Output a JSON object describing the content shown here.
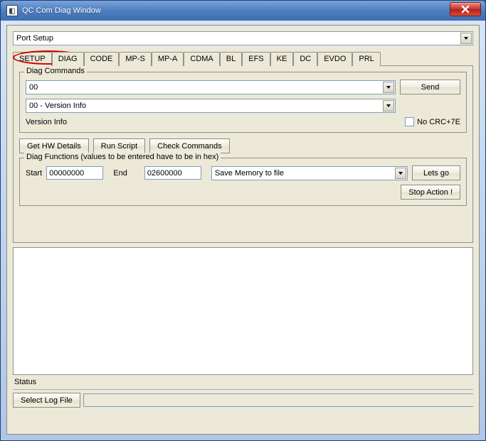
{
  "window": {
    "title": "QC Com Diag Window"
  },
  "port_dropdown": {
    "value": "Port Setup"
  },
  "tabs": [
    {
      "label": "SETUP"
    },
    {
      "label": "DIAG"
    },
    {
      "label": "CODE"
    },
    {
      "label": "MP-S"
    },
    {
      "label": "MP-A"
    },
    {
      "label": "CDMA"
    },
    {
      "label": "BL"
    },
    {
      "label": "EFS"
    },
    {
      "label": "KE"
    },
    {
      "label": "DC"
    },
    {
      "label": "EVDO"
    },
    {
      "label": "PRL"
    }
  ],
  "diag_commands": {
    "group_title": "Diag Commands",
    "cmd_value": "00",
    "send_label": "Send",
    "info_select": "00 - Version Info",
    "info_text": "Version Info",
    "no_crc_label": "No CRC+7E"
  },
  "buttons_row": {
    "hw_details": "Get HW Details",
    "run_script": "Run Script",
    "check_cmds": "Check Commands"
  },
  "diag_functions": {
    "group_title": "Diag Functions (values to be entered have to be in hex)",
    "start_label": "Start",
    "start_value": "00000000",
    "end_label": "End",
    "end_value": "02600000",
    "action_select": "Save Memory to file",
    "go_label": "Lets go",
    "stop_label": "Stop Action !"
  },
  "status_label": "Status",
  "select_log_label": "Select Log File"
}
